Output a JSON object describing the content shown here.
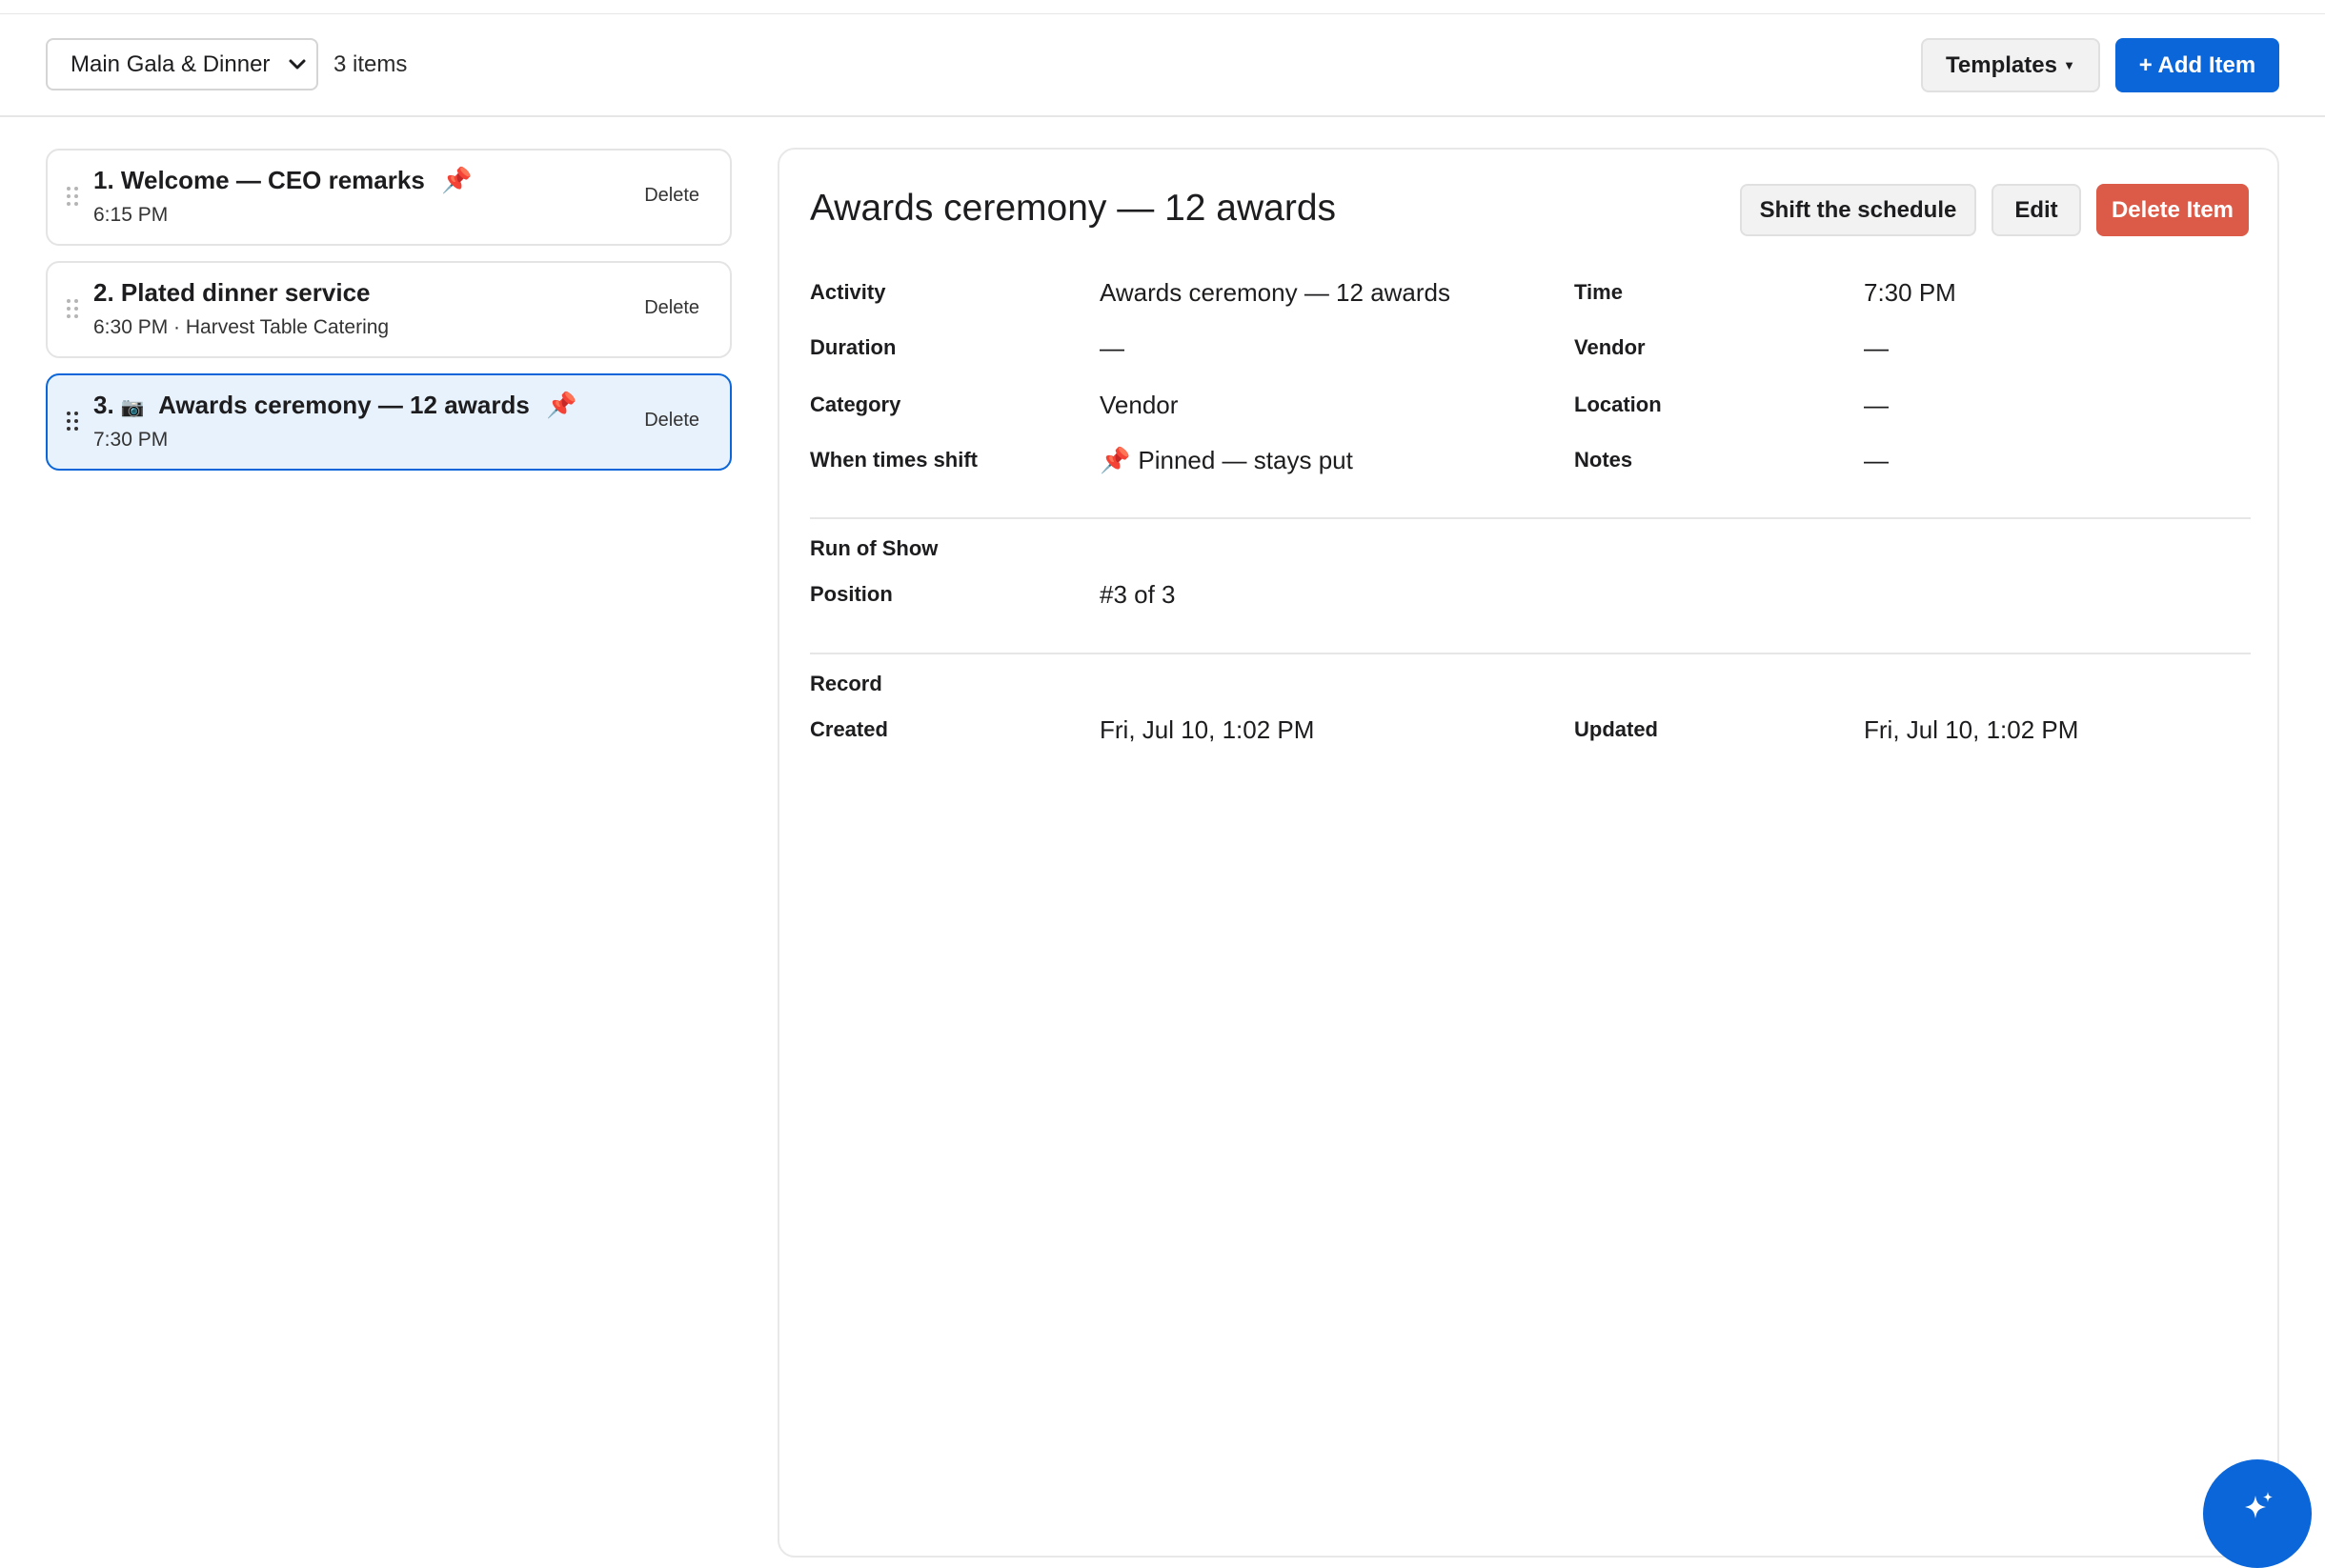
{
  "toolbar": {
    "event_select": "Main Gala & Dinner",
    "item_count": "3 items",
    "templates_label": "Templates",
    "templates_caret": "▼",
    "add_label": "+ Add Item"
  },
  "items": [
    {
      "number": "1.",
      "title": "Welcome — CEO remarks",
      "pinned": true,
      "icon": "",
      "sub": "6:15 PM",
      "delete": "Delete"
    },
    {
      "number": "2.",
      "title": "Plated dinner service",
      "pinned": false,
      "icon": "",
      "sub": "6:30 PM · Harvest Table Catering",
      "delete": "Delete"
    },
    {
      "number": "3.",
      "title": "Awards ceremony — 12 awards",
      "pinned": true,
      "icon": "📷",
      "sub": "7:30 PM",
      "delete": "Delete"
    }
  ],
  "detail": {
    "title": "Awards ceremony — 12 awards",
    "shift_label": "Shift the schedule",
    "edit_label": "Edit",
    "delete_label": "Delete Item",
    "fields": {
      "activity_label": "Activity",
      "activity": "Awards ceremony — 12 awards",
      "time_label": "Time",
      "time": "7:30 PM",
      "duration_label": "Duration",
      "duration": "—",
      "vendor_label": "Vendor",
      "vendor": "—",
      "category_label": "Category",
      "category": "Vendor",
      "location_label": "Location",
      "location": "—",
      "shift_label": "When times shift",
      "shift": "Pinned — stays put",
      "notes_label": "Notes",
      "notes": "—"
    },
    "run_of_show": {
      "heading": "Run of Show",
      "position_label": "Position",
      "position": "#3 of 3"
    },
    "record": {
      "heading": "Record",
      "created_label": "Created",
      "created": "Fri, Jul 10, 1:02 PM",
      "updated_label": "Updated",
      "updated": "Fri, Jul 10, 1:02 PM"
    }
  },
  "pin_glyph": "📌",
  "colors": {
    "accent": "#0a66d9",
    "danger": "#dc5a48",
    "pin": "#d6345a",
    "selected_bg": "#e8f2fc"
  }
}
